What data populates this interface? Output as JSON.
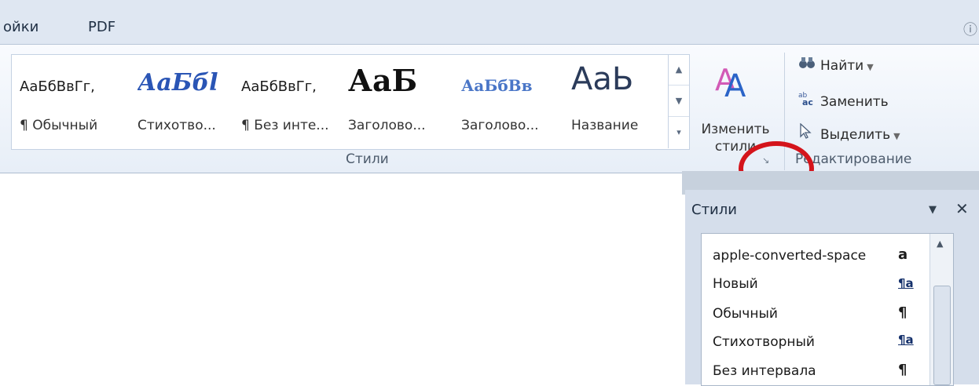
{
  "tabs": [
    {
      "label": "ойки"
    },
    {
      "label": "PDF"
    }
  ],
  "corner_glyph": "ⓘ",
  "styles_gallery": {
    "items": [
      {
        "sample": "АаБбВвГг,",
        "name": "¶ Обычный"
      },
      {
        "sample": "АаБбl",
        "name": "Стихотво..."
      },
      {
        "sample": "АаБбВвГг,",
        "name": "¶ Без инте..."
      },
      {
        "sample": "АаБ",
        "name": "Заголово..."
      },
      {
        "sample": "АаБбВв",
        "name": "Заголово..."
      },
      {
        "sample": "АаЬ",
        "name": "Название"
      }
    ],
    "group_label": "Стили"
  },
  "change_styles": {
    "label": "Изменить стили"
  },
  "editing": {
    "find_label": "Найти",
    "replace_label": "Заменить",
    "select_label": "Выделить",
    "group_label": "Редактирование"
  },
  "styles_pane": {
    "title": "Стили",
    "items": [
      {
        "label": "apple-converted-space",
        "mark": "a"
      },
      {
        "label": "Новый",
        "mark": "¶a"
      },
      {
        "label": "Обычный",
        "mark": "¶"
      },
      {
        "label": "Стихотворный",
        "mark": "¶a"
      },
      {
        "label": "Без интервала",
        "mark": "¶"
      }
    ]
  },
  "colors": {
    "highlight_ring": "#d4141b",
    "heading_sample": "#4a76c7"
  }
}
